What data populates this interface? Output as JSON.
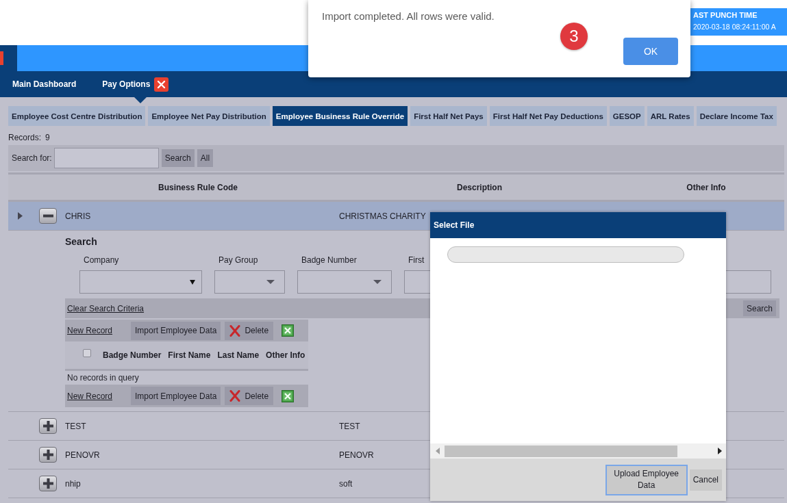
{
  "header": {
    "punch_label": "AST PUNCH TIME",
    "punch_value": "2020-03-18 08:24:11:00 A"
  },
  "alert": {
    "message": "Import completed. All rows were valid.",
    "step_badge": "3",
    "button": "OK"
  },
  "nav": {
    "items": [
      {
        "label": "Main Dashboard",
        "selected": false,
        "closable": false
      },
      {
        "label": "Pay Options",
        "selected": true,
        "closable": true
      }
    ]
  },
  "tabs": [
    {
      "label": "Employee Cost Centre Distribution",
      "selected": false
    },
    {
      "label": "Employee Net Pay Distribution",
      "selected": false
    },
    {
      "label": "Employee Business Rule Override",
      "selected": true
    },
    {
      "label": "First Half Net Pays",
      "selected": false
    },
    {
      "label": "First Half Net Pay Deductions",
      "selected": false
    },
    {
      "label": "GESOP",
      "selected": false
    },
    {
      "label": "ARL Rates",
      "selected": false
    },
    {
      "label": "Declare Income Tax",
      "selected": false
    }
  ],
  "records": {
    "label": "Records:",
    "count": "9"
  },
  "search": {
    "label": "Search for:",
    "buttons": [
      "Search",
      "All"
    ]
  },
  "table": {
    "columns": [
      "Business Rule Code",
      "Description",
      "Other Info"
    ],
    "rows": [
      {
        "code": "CHRIS",
        "description": "CHRISTMAS CHARITY",
        "selected": true,
        "expanded": true
      },
      {
        "code": "TEST",
        "description": "TEST",
        "selected": false,
        "expanded": false
      },
      {
        "code": "PENOVR",
        "description": "PENOVR",
        "selected": false,
        "expanded": false
      },
      {
        "code": "nhip",
        "description": "soft",
        "selected": false,
        "expanded": false
      }
    ]
  },
  "detail": {
    "title": "Search",
    "filters": [
      {
        "label": "Company",
        "kind": "native-select"
      },
      {
        "label": "Pay Group",
        "kind": "select"
      },
      {
        "label": "Badge Number",
        "kind": "select"
      },
      {
        "label": "First",
        "kind": "text"
      }
    ],
    "clear_link": "Clear Search Criteria",
    "search_button": "Search",
    "toolbars": [
      {
        "new_link": "New Record",
        "import_button": "Import Employee Data",
        "delete_button": "Delete"
      },
      {
        "new_link": "New Record",
        "import_button": "Import Employee Data",
        "delete_button": "Delete"
      }
    ],
    "grid": {
      "select_all_checked": false,
      "columns": [
        "Badge Number",
        "First Name",
        "Last Name",
        "Other Info"
      ],
      "empty_message": "No records in query"
    }
  },
  "select_file_dialog": {
    "title": "Select File",
    "buttons": [
      {
        "label": "Upload Employee Data",
        "focused": true
      },
      {
        "label": "Cancel",
        "focused": false
      }
    ]
  }
}
